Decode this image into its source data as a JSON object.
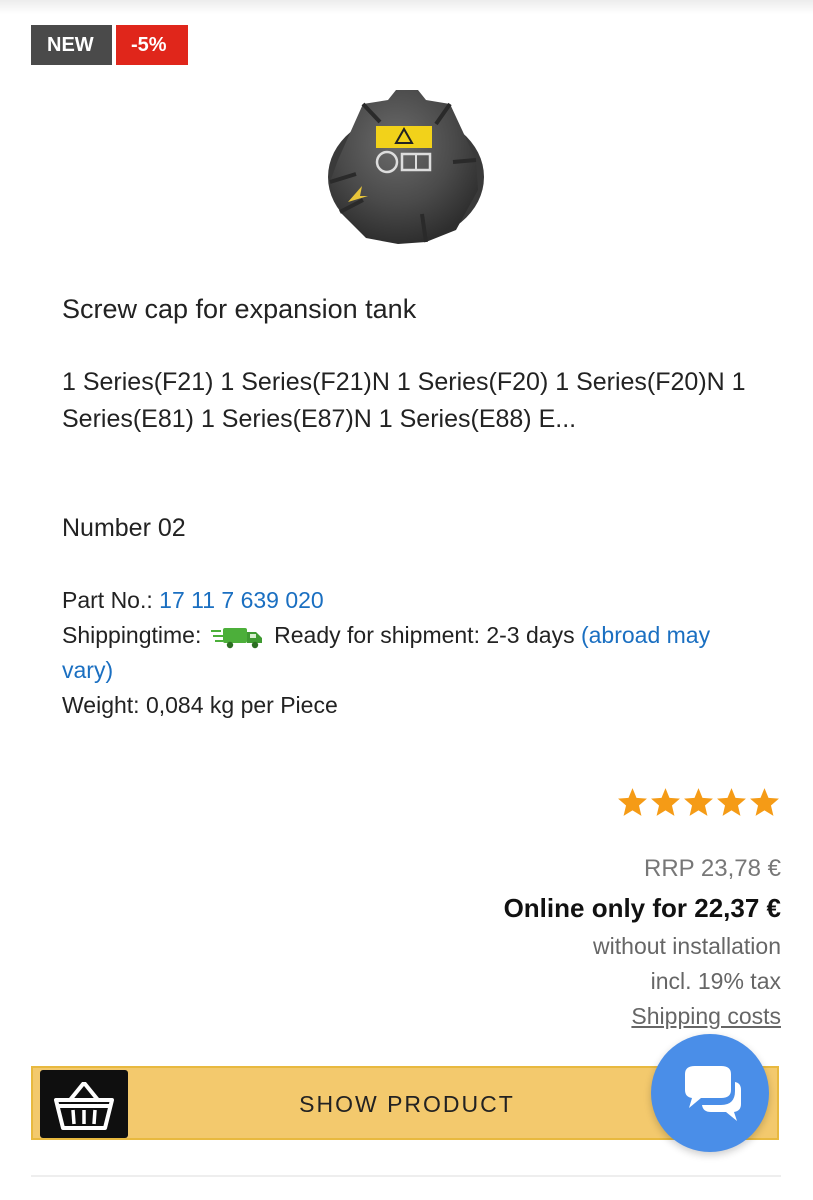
{
  "badges": {
    "new": "NEW",
    "discount": "-5%"
  },
  "product": {
    "title": "Screw cap for expansion tank",
    "models": "1 Series(F21) 1 Series(F21)N 1 Series(F20) 1 Series(F20)N 1 Series(E81) 1 Series(E87)N 1 Series(E88) E...",
    "number": "Number 02",
    "part_label": "Part No.:",
    "part_number": "17 11 7 639 020",
    "shipping_label": "Shippingtime:",
    "shipping_text": "Ready for shipment: 2-3 days",
    "shipping_note": "(abroad may vary)",
    "weight": "Weight: 0,084 kg per Piece",
    "rating_stars": 5
  },
  "pricing": {
    "rrp": "RRP 23,78 €",
    "online": "Online only for 22,37 €",
    "installation": "without installation",
    "tax": "incl. 19% tax",
    "shipping_costs": "Shipping costs"
  },
  "actions": {
    "show_product": "SHOW PRODUCT"
  },
  "icons": {
    "basket": "shopping-basket-icon",
    "truck": "delivery-truck-icon",
    "chat": "chat-bubbles-icon",
    "star": "star-icon"
  },
  "colors": {
    "sale_badge": "#e0261b",
    "new_badge": "#4a4a4a",
    "link": "#1a6fc1",
    "star": "#f59b16",
    "button": "#f3c96d",
    "chat": "#4a8ee8"
  }
}
